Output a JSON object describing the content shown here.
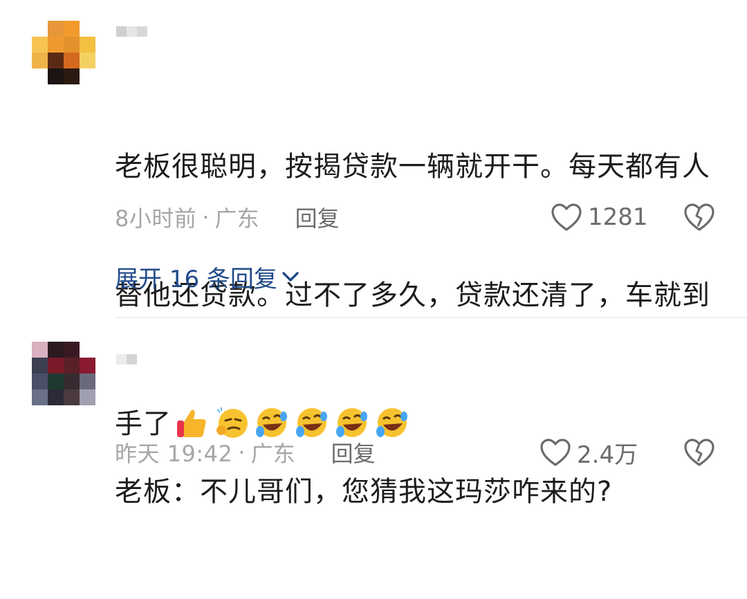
{
  "comments": [
    {
      "text_line1": "老板很聪明，按揭贷款一辆就开干。每天都有人",
      "text_line2": "替他还贷款。过不了多久，贷款还清了，车就到",
      "text_line3": "手了",
      "emojis": [
        "thumbs-up-icon",
        "smug-face-icon",
        "rofl-icon",
        "rofl-icon",
        "rofl-icon",
        "rofl-icon"
      ],
      "time": "8小时前",
      "location": "广东",
      "reply_label": "回复",
      "like_count": "1281",
      "expand_label": "展开 16 条回复"
    },
    {
      "text_line1": "老板：不儿哥们，您猜我这玛莎咋来的?",
      "time": "昨天 19:42",
      "location": "广东",
      "reply_label": "回复",
      "like_count": "2.4万"
    }
  ],
  "colors": {
    "link_blue": "#1f4a8a",
    "meta_gray": "#a6a6a6",
    "action_gray": "#6b6b6b"
  }
}
